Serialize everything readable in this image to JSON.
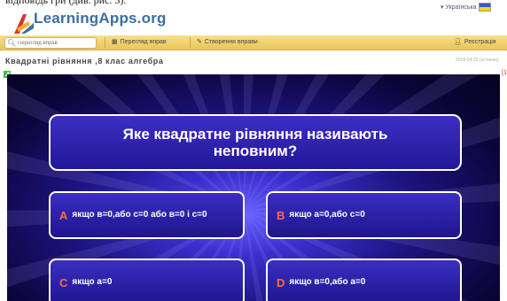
{
  "caption": "відповідь гри (див. рис. 3).",
  "header": {
    "logo_text": "LearningApps.org",
    "language": "Українська"
  },
  "navbar": {
    "search_placeholder": "Перегляд вправ",
    "browse_label": "Перегляд вправ",
    "create_label": "Створення вправи",
    "register_label": "Реєстрація"
  },
  "page": {
    "title": "Квадратні рівняння ,8 клас алгебра",
    "date": "2018-04-22 (останнє)"
  },
  "game": {
    "question": "Яке квадратне рівняння називають неповним?",
    "answers": [
      {
        "letter": "A",
        "text": "якщо в=0,або с=0 або в=0 і с=0"
      },
      {
        "letter": "B",
        "text": "якщо а=0,або с=0"
      },
      {
        "letter": "C",
        "text": "якщо а=0"
      },
      {
        "letter": "D",
        "text": "якщо в=0,або а=0"
      }
    ]
  },
  "colors": {
    "navbar": "#f1d171",
    "answer_letter": "#ff6a4a",
    "game_bg": "#1c137e"
  }
}
